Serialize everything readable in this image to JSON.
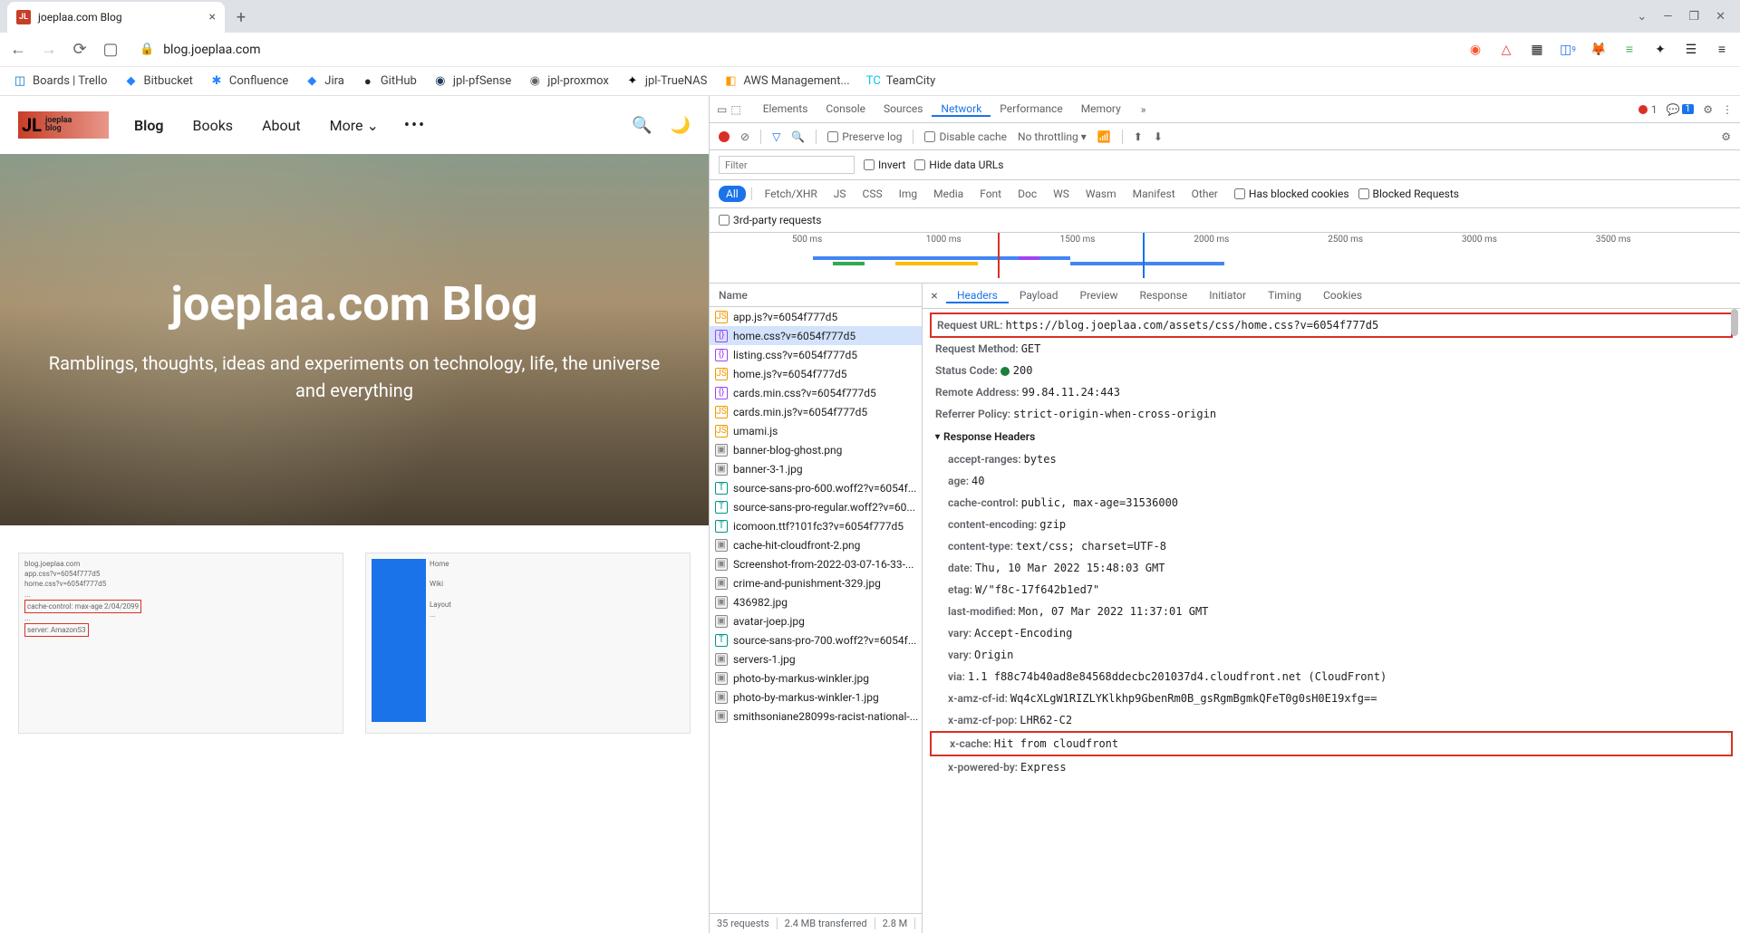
{
  "browser": {
    "tab_title": "joeplaa.com Blog",
    "url_display": "blog.joeplaa.com",
    "window_controls": {
      "dropdown": "⌄",
      "min": "—",
      "max": "❐",
      "close": "✕"
    }
  },
  "bookmarks": [
    {
      "label": "Boards | Trello",
      "icon": "◫",
      "color": "#0079bf"
    },
    {
      "label": "Bitbucket",
      "icon": "◆",
      "color": "#2684ff"
    },
    {
      "label": "Confluence",
      "icon": "✱",
      "color": "#2684ff"
    },
    {
      "label": "Jira",
      "icon": "◆",
      "color": "#2684ff"
    },
    {
      "label": "GitHub",
      "icon": "●",
      "color": "#24292e"
    },
    {
      "label": "jpl-pfSense",
      "icon": "◉",
      "color": "#1e3a5f"
    },
    {
      "label": "jpl-proxmox",
      "icon": "◉",
      "color": "#5f6368"
    },
    {
      "label": "jpl-TrueNAS",
      "icon": "✦",
      "color": "#000"
    },
    {
      "label": "AWS Management...",
      "icon": "◧",
      "color": "#ff9900"
    },
    {
      "label": "TeamCity",
      "icon": "TC",
      "color": "#07c3f2"
    }
  ],
  "site": {
    "logo_text1": "JL",
    "logo_text2": "joeplaa\nblog",
    "nav": [
      "Blog",
      "Books",
      "About",
      "More"
    ],
    "hero_title": "joeplaa.com Blog",
    "hero_subtitle": "Ramblings, thoughts, ideas and experiments on technology, life, the universe and everything"
  },
  "devtools": {
    "panels": [
      "Elements",
      "Console",
      "Sources",
      "Network",
      "Performance",
      "Memory"
    ],
    "active_panel": "Network",
    "issues_count": "1",
    "toolbar": {
      "preserve_log": "Preserve log",
      "disable_cache": "Disable cache",
      "throttling": "No throttling"
    },
    "filter_placeholder": "Filter",
    "invert_label": "Invert",
    "hide_data_label": "Hide data URLs",
    "type_filters": [
      "All",
      "Fetch/XHR",
      "JS",
      "CSS",
      "Img",
      "Media",
      "Font",
      "Doc",
      "WS",
      "Wasm",
      "Manifest",
      "Other"
    ],
    "blocked_cookies": "Has blocked cookies",
    "blocked_requests": "Blocked Requests",
    "third_party": "3rd-party requests",
    "timeline_ticks": [
      "500 ms",
      "1000 ms",
      "1500 ms",
      "2000 ms",
      "2500 ms",
      "3000 ms",
      "3500 ms"
    ],
    "name_header": "Name",
    "requests": [
      {
        "name": "app.js?v=6054f777d5",
        "type": "js"
      },
      {
        "name": "home.css?v=6054f777d5",
        "type": "css",
        "selected": true
      },
      {
        "name": "listing.css?v=6054f777d5",
        "type": "css"
      },
      {
        "name": "home.js?v=6054f777d5",
        "type": "js"
      },
      {
        "name": "cards.min.css?v=6054f777d5",
        "type": "css"
      },
      {
        "name": "cards.min.js?v=6054f777d5",
        "type": "js"
      },
      {
        "name": "umami.js",
        "type": "js"
      },
      {
        "name": "banner-blog-ghost.png",
        "type": "img"
      },
      {
        "name": "banner-3-1.jpg",
        "type": "img"
      },
      {
        "name": "source-sans-pro-600.woff2?v=6054f...",
        "type": "font"
      },
      {
        "name": "source-sans-pro-regular.woff2?v=60...",
        "type": "font"
      },
      {
        "name": "icomoon.ttf?101fc3?v=6054f777d5",
        "type": "font"
      },
      {
        "name": "cache-hit-cloudfront-2.png",
        "type": "img"
      },
      {
        "name": "Screenshot-from-2022-03-07-16-33-...",
        "type": "img"
      },
      {
        "name": "crime-and-punishment-329.jpg",
        "type": "img"
      },
      {
        "name": "436982.jpg",
        "type": "img"
      },
      {
        "name": "avatar-joep.jpg",
        "type": "img"
      },
      {
        "name": "source-sans-pro-700.woff2?v=6054f...",
        "type": "font"
      },
      {
        "name": "servers-1.jpg",
        "type": "img"
      },
      {
        "name": "photo-by-markus-winkler.jpg",
        "type": "img"
      },
      {
        "name": "photo-by-markus-winkler-1.jpg",
        "type": "img"
      },
      {
        "name": "smithsoniane28099s-racist-national-...",
        "type": "img"
      }
    ],
    "status_bar": {
      "requests": "35 requests",
      "transferred": "2.4 MB transferred",
      "resources": "2.8 M"
    },
    "detail_tabs": [
      "Headers",
      "Payload",
      "Preview",
      "Response",
      "Initiator",
      "Timing",
      "Cookies"
    ],
    "general": {
      "request_url_k": "Request URL:",
      "request_url_v": "https://blog.joeplaa.com/assets/css/home.css?v=6054f777d5",
      "request_method_k": "Request Method:",
      "request_method_v": "GET",
      "status_code_k": "Status Code:",
      "status_code_v": "200",
      "remote_addr_k": "Remote Address:",
      "remote_addr_v": "99.84.11.24:443",
      "referrer_k": "Referrer Policy:",
      "referrer_v": "strict-origin-when-cross-origin"
    },
    "response_headers_label": "Response Headers",
    "response_headers": [
      {
        "k": "accept-ranges:",
        "v": "bytes"
      },
      {
        "k": "age:",
        "v": "40"
      },
      {
        "k": "cache-control:",
        "v": "public, max-age=31536000"
      },
      {
        "k": "content-encoding:",
        "v": "gzip"
      },
      {
        "k": "content-type:",
        "v": "text/css; charset=UTF-8"
      },
      {
        "k": "date:",
        "v": "Thu, 10 Mar 2022 15:48:03 GMT"
      },
      {
        "k": "etag:",
        "v": "W/\"f8c-17f642b1ed7\""
      },
      {
        "k": "last-modified:",
        "v": "Mon, 07 Mar 2022 11:37:01 GMT"
      },
      {
        "k": "vary:",
        "v": "Accept-Encoding"
      },
      {
        "k": "vary:",
        "v": "Origin"
      },
      {
        "k": "via:",
        "v": "1.1 f88c74b40ad8e84568ddecbc201037d4.cloudfront.net (CloudFront)"
      },
      {
        "k": "x-amz-cf-id:",
        "v": "Wq4cXLgW1RIZLYKlkhp9GbenRm0B_gsRgmBgmkQFeT0g0sH0E19xfg=="
      },
      {
        "k": "x-amz-cf-pop:",
        "v": "LHR62-C2"
      },
      {
        "k": "x-cache:",
        "v": "Hit from cloudfront",
        "boxed": true
      },
      {
        "k": "x-powered-by:",
        "v": "Express"
      }
    ]
  }
}
